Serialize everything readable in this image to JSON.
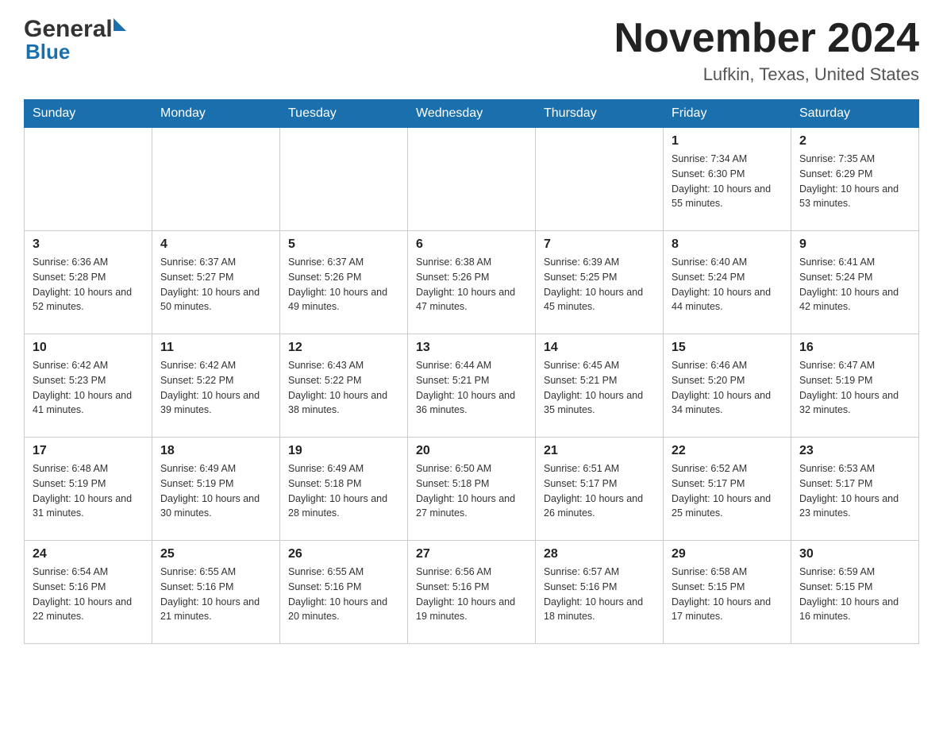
{
  "header": {
    "logo_general": "General",
    "logo_blue": "Blue",
    "month_title": "November 2024",
    "location": "Lufkin, Texas, United States"
  },
  "days_of_week": [
    "Sunday",
    "Monday",
    "Tuesday",
    "Wednesday",
    "Thursday",
    "Friday",
    "Saturday"
  ],
  "weeks": [
    [
      {
        "day": "",
        "sunrise": "",
        "sunset": "",
        "daylight": ""
      },
      {
        "day": "",
        "sunrise": "",
        "sunset": "",
        "daylight": ""
      },
      {
        "day": "",
        "sunrise": "",
        "sunset": "",
        "daylight": ""
      },
      {
        "day": "",
        "sunrise": "",
        "sunset": "",
        "daylight": ""
      },
      {
        "day": "",
        "sunrise": "",
        "sunset": "",
        "daylight": ""
      },
      {
        "day": "1",
        "sunrise": "Sunrise: 7:34 AM",
        "sunset": "Sunset: 6:30 PM",
        "daylight": "Daylight: 10 hours and 55 minutes."
      },
      {
        "day": "2",
        "sunrise": "Sunrise: 7:35 AM",
        "sunset": "Sunset: 6:29 PM",
        "daylight": "Daylight: 10 hours and 53 minutes."
      }
    ],
    [
      {
        "day": "3",
        "sunrise": "Sunrise: 6:36 AM",
        "sunset": "Sunset: 5:28 PM",
        "daylight": "Daylight: 10 hours and 52 minutes."
      },
      {
        "day": "4",
        "sunrise": "Sunrise: 6:37 AM",
        "sunset": "Sunset: 5:27 PM",
        "daylight": "Daylight: 10 hours and 50 minutes."
      },
      {
        "day": "5",
        "sunrise": "Sunrise: 6:37 AM",
        "sunset": "Sunset: 5:26 PM",
        "daylight": "Daylight: 10 hours and 49 minutes."
      },
      {
        "day": "6",
        "sunrise": "Sunrise: 6:38 AM",
        "sunset": "Sunset: 5:26 PM",
        "daylight": "Daylight: 10 hours and 47 minutes."
      },
      {
        "day": "7",
        "sunrise": "Sunrise: 6:39 AM",
        "sunset": "Sunset: 5:25 PM",
        "daylight": "Daylight: 10 hours and 45 minutes."
      },
      {
        "day": "8",
        "sunrise": "Sunrise: 6:40 AM",
        "sunset": "Sunset: 5:24 PM",
        "daylight": "Daylight: 10 hours and 44 minutes."
      },
      {
        "day": "9",
        "sunrise": "Sunrise: 6:41 AM",
        "sunset": "Sunset: 5:24 PM",
        "daylight": "Daylight: 10 hours and 42 minutes."
      }
    ],
    [
      {
        "day": "10",
        "sunrise": "Sunrise: 6:42 AM",
        "sunset": "Sunset: 5:23 PM",
        "daylight": "Daylight: 10 hours and 41 minutes."
      },
      {
        "day": "11",
        "sunrise": "Sunrise: 6:42 AM",
        "sunset": "Sunset: 5:22 PM",
        "daylight": "Daylight: 10 hours and 39 minutes."
      },
      {
        "day": "12",
        "sunrise": "Sunrise: 6:43 AM",
        "sunset": "Sunset: 5:22 PM",
        "daylight": "Daylight: 10 hours and 38 minutes."
      },
      {
        "day": "13",
        "sunrise": "Sunrise: 6:44 AM",
        "sunset": "Sunset: 5:21 PM",
        "daylight": "Daylight: 10 hours and 36 minutes."
      },
      {
        "day": "14",
        "sunrise": "Sunrise: 6:45 AM",
        "sunset": "Sunset: 5:21 PM",
        "daylight": "Daylight: 10 hours and 35 minutes."
      },
      {
        "day": "15",
        "sunrise": "Sunrise: 6:46 AM",
        "sunset": "Sunset: 5:20 PM",
        "daylight": "Daylight: 10 hours and 34 minutes."
      },
      {
        "day": "16",
        "sunrise": "Sunrise: 6:47 AM",
        "sunset": "Sunset: 5:19 PM",
        "daylight": "Daylight: 10 hours and 32 minutes."
      }
    ],
    [
      {
        "day": "17",
        "sunrise": "Sunrise: 6:48 AM",
        "sunset": "Sunset: 5:19 PM",
        "daylight": "Daylight: 10 hours and 31 minutes."
      },
      {
        "day": "18",
        "sunrise": "Sunrise: 6:49 AM",
        "sunset": "Sunset: 5:19 PM",
        "daylight": "Daylight: 10 hours and 30 minutes."
      },
      {
        "day": "19",
        "sunrise": "Sunrise: 6:49 AM",
        "sunset": "Sunset: 5:18 PM",
        "daylight": "Daylight: 10 hours and 28 minutes."
      },
      {
        "day": "20",
        "sunrise": "Sunrise: 6:50 AM",
        "sunset": "Sunset: 5:18 PM",
        "daylight": "Daylight: 10 hours and 27 minutes."
      },
      {
        "day": "21",
        "sunrise": "Sunrise: 6:51 AM",
        "sunset": "Sunset: 5:17 PM",
        "daylight": "Daylight: 10 hours and 26 minutes."
      },
      {
        "day": "22",
        "sunrise": "Sunrise: 6:52 AM",
        "sunset": "Sunset: 5:17 PM",
        "daylight": "Daylight: 10 hours and 25 minutes."
      },
      {
        "day": "23",
        "sunrise": "Sunrise: 6:53 AM",
        "sunset": "Sunset: 5:17 PM",
        "daylight": "Daylight: 10 hours and 23 minutes."
      }
    ],
    [
      {
        "day": "24",
        "sunrise": "Sunrise: 6:54 AM",
        "sunset": "Sunset: 5:16 PM",
        "daylight": "Daylight: 10 hours and 22 minutes."
      },
      {
        "day": "25",
        "sunrise": "Sunrise: 6:55 AM",
        "sunset": "Sunset: 5:16 PM",
        "daylight": "Daylight: 10 hours and 21 minutes."
      },
      {
        "day": "26",
        "sunrise": "Sunrise: 6:55 AM",
        "sunset": "Sunset: 5:16 PM",
        "daylight": "Daylight: 10 hours and 20 minutes."
      },
      {
        "day": "27",
        "sunrise": "Sunrise: 6:56 AM",
        "sunset": "Sunset: 5:16 PM",
        "daylight": "Daylight: 10 hours and 19 minutes."
      },
      {
        "day": "28",
        "sunrise": "Sunrise: 6:57 AM",
        "sunset": "Sunset: 5:16 PM",
        "daylight": "Daylight: 10 hours and 18 minutes."
      },
      {
        "day": "29",
        "sunrise": "Sunrise: 6:58 AM",
        "sunset": "Sunset: 5:15 PM",
        "daylight": "Daylight: 10 hours and 17 minutes."
      },
      {
        "day": "30",
        "sunrise": "Sunrise: 6:59 AM",
        "sunset": "Sunset: 5:15 PM",
        "daylight": "Daylight: 10 hours and 16 minutes."
      }
    ]
  ]
}
